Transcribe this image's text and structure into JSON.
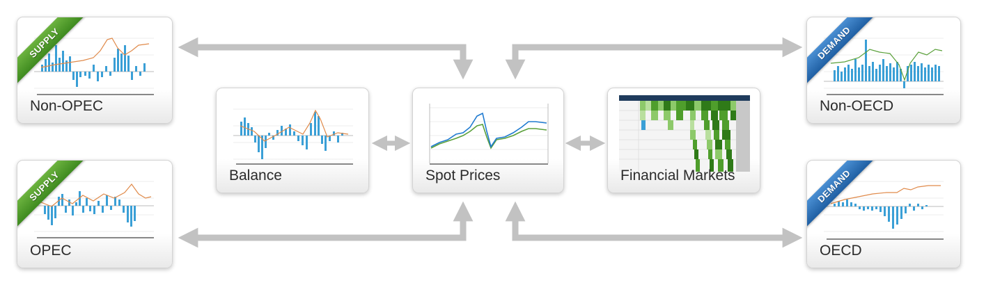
{
  "nodes": {
    "non_opec": {
      "title": "Non-OPEC",
      "ribbon": "SUPPLY"
    },
    "opec": {
      "title": "OPEC",
      "ribbon": "SUPPLY"
    },
    "balance": {
      "title": "Balance"
    },
    "spot_prices": {
      "title": "Spot Prices"
    },
    "financial_markets": {
      "title": "Financial Markets"
    },
    "non_oecd": {
      "title": "Non-OECD",
      "ribbon": "DEMAND"
    },
    "oecd": {
      "title": "OECD",
      "ribbon": "DEMAND"
    }
  },
  "colors": {
    "supply_ribbon": "#4f9e2c",
    "demand_ribbon": "#2f76c0",
    "bars": "#3a9fd6",
    "line_orange": "#e08a4a",
    "line_green": "#5aa03a",
    "line_blue": "#1e7ad0",
    "arrow": "#c2c2c2",
    "heatmap_header": "#1f3b5c"
  }
}
